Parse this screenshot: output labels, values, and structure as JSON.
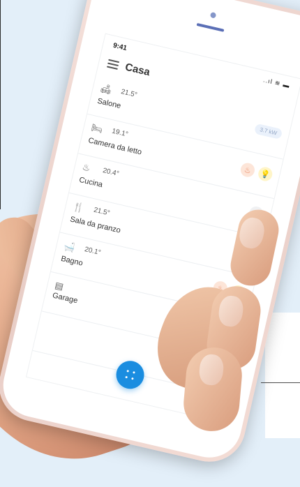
{
  "status_bar": {
    "time": "9:41",
    "icons": "..ıl ≋ ▬"
  },
  "header": {
    "title": "Casa"
  },
  "rooms": [
    {
      "name": "Salone",
      "temperature": "21.5°",
      "icon": "sofa-icon",
      "power": "3.7 kW",
      "badges": []
    },
    {
      "name": "Camera da letto",
      "temperature": "19.1°",
      "icon": "bed-icon",
      "badges": [
        "flame",
        "bulb"
      ]
    },
    {
      "name": "Cucina",
      "temperature": "20.4°",
      "icon": "cooking-pot-icon",
      "badges": [
        "bulb-off"
      ]
    },
    {
      "name": "Sala da pranzo",
      "temperature": "21.5°",
      "icon": "fork-knife-icon",
      "badges": [
        "bulb"
      ]
    },
    {
      "name": "Bagno",
      "temperature": "20.1°",
      "icon": "bathtub-icon",
      "badges": [
        "flame",
        "bulb"
      ]
    },
    {
      "name": "Garage",
      "temperature": "",
      "icon": "garage-icon",
      "badges": [
        "bulb-off"
      ]
    },
    {
      "name": "",
      "temperature": "",
      "icon": "",
      "badges": [
        "bulb-off"
      ]
    }
  ],
  "colors": {
    "accent": "#1a8de0",
    "flame": "#e8815a",
    "bulb_on": "#e3bf2a",
    "bulb_off": "#b8bcc2"
  }
}
